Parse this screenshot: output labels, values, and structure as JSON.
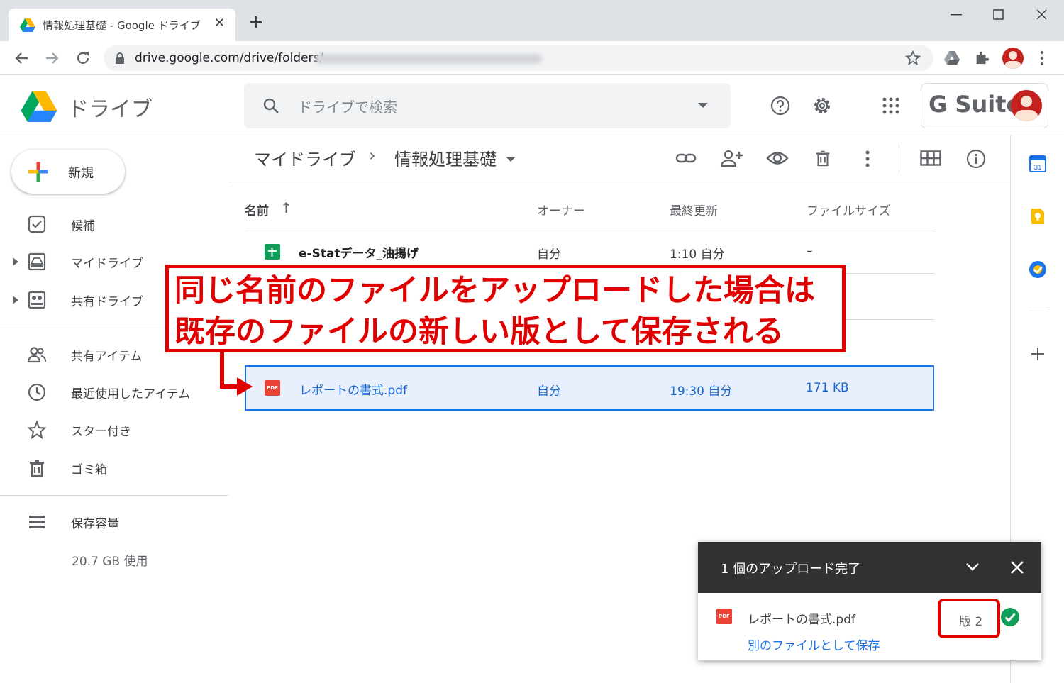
{
  "browser": {
    "tab_title": "情報処理基礎 - Google ドライブ",
    "tab_close": "✕",
    "new_tab": "+",
    "url": "drive.google.com/drive/folders/"
  },
  "header": {
    "app_name": "ドライブ",
    "search_placeholder": "ドライブで検索",
    "gsuite_label": "G Suite"
  },
  "sidebar": {
    "new_label": "新規",
    "items": [
      {
        "label": "候補"
      },
      {
        "label": "マイドライブ"
      },
      {
        "label": "共有ドライブ"
      },
      {
        "label": "共有アイテム"
      },
      {
        "label": "最近使用したアイテム"
      },
      {
        "label": "スター付き"
      },
      {
        "label": "ゴミ箱"
      },
      {
        "label": "保存容量"
      }
    ],
    "storage_used": "20.7 GB 使用"
  },
  "main": {
    "breadcrumb_root": "マイドライブ",
    "breadcrumb_sep": "›",
    "breadcrumb_current": "情報処理基礎",
    "columns": {
      "name": "名前",
      "sort_arrow": "↑",
      "owner": "オーナー",
      "modified": "最終更新",
      "size": "ファイルサイズ"
    },
    "files": [
      {
        "name": "e-Statデータ_油揚げ",
        "owner": "自分",
        "modified": "1:10 自分",
        "size": "–"
      },
      {
        "name": "レポートの書式.pdf",
        "owner": "自分",
        "modified": "19:30 自分",
        "size": "171 KB"
      }
    ]
  },
  "annotation": {
    "line1": "同じ名前のファイルをアップロードした場合は",
    "line2": "既存のファイルの新しい版として保存される"
  },
  "toast": {
    "title": "1 個のアップロード完了",
    "file_name": "レポートの書式.pdf",
    "version": "版 2",
    "save_as_new": "別のファイルとして保存"
  },
  "colors": {
    "accent": "#1a73e8",
    "annotation_red": "#e00000",
    "selected_row": "#e8f0fe"
  }
}
